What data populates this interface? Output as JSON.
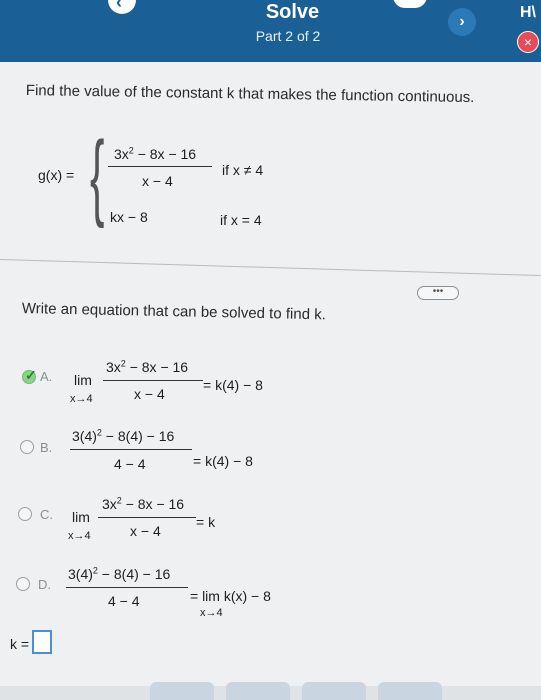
{
  "header": {
    "title": "Solve",
    "subtitle": "Part 2 of 2",
    "hw_label": "H\\",
    "next_symbol": "›",
    "close_symbol": "×",
    "back_symbol": "‹"
  },
  "question": {
    "text": "Find the value of the constant k that makes the function continuous.",
    "function_label": "g(x)  =",
    "piece1_numerator_a": "3x",
    "piece1_numerator_exp": "2",
    "piece1_numerator_b": " − 8x − 16",
    "piece1_denominator": "x − 4",
    "piece1_condition": "if x ≠ 4",
    "piece2_expr": "kx − 8",
    "piece2_condition": "if x = 4"
  },
  "more_label": "•••",
  "prompt": "Write an equation that can be solved to find k.",
  "options": {
    "a": {
      "letter": "A.",
      "lim": "lim",
      "sub": "x→4",
      "num_a": "3x",
      "num_exp": "2",
      "num_b": " − 8x − 16",
      "den": "x − 4",
      "rhs": "= k(4) − 8",
      "selected": true
    },
    "b": {
      "letter": "B.",
      "num_a": "3(4)",
      "num_exp": "2",
      "num_b": " − 8(4) − 16",
      "den": "4 − 4",
      "rhs": "= k(4) − 8"
    },
    "c": {
      "letter": "C.",
      "lim": "lim",
      "sub": "x→4",
      "num_a": "3x",
      "num_exp": "2",
      "num_b": " − 8x − 16",
      "den": "x − 4",
      "rhs": "= k"
    },
    "d": {
      "letter": "D.",
      "num_a": "3(4)",
      "num_exp": "2",
      "num_b": " − 8(4) − 16",
      "den": "4 − 4",
      "rhs": "=  lim k(x) − 8",
      "rhs_sub": "x→4"
    }
  },
  "answer": {
    "label": "k =",
    "value": ""
  },
  "colors": {
    "header": "#1b5f97",
    "accent": "#4b8fd6",
    "close": "#e84b55",
    "correct": "#8fd18a"
  }
}
